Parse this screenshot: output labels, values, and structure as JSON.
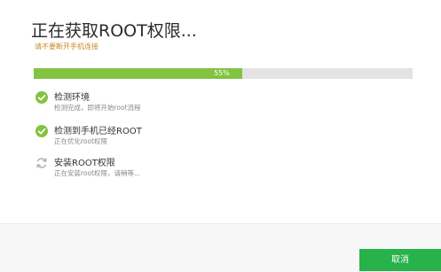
{
  "header": {
    "title": "正在获取ROOT权限...",
    "subtitle": "请不要断开手机连接"
  },
  "progress": {
    "percent": 55,
    "label": "55%"
  },
  "steps": [
    {
      "title": "检测环境",
      "description": "检测完成，即将开始root流程",
      "status": "done",
      "icon": "check-circle-icon"
    },
    {
      "title": "检测到手机已经ROOT",
      "description": "正在优化root权限",
      "status": "done",
      "icon": "check-circle-icon"
    },
    {
      "title": "安装ROOT权限",
      "description": "正在安装root权限，请稍等...",
      "status": "in-progress",
      "icon": "refresh-icon"
    }
  ],
  "footer": {
    "cancel_label": "取消"
  },
  "colors": {
    "accent": "#82c341",
    "button": "#27b24a",
    "subtitle": "#c98a2a"
  }
}
